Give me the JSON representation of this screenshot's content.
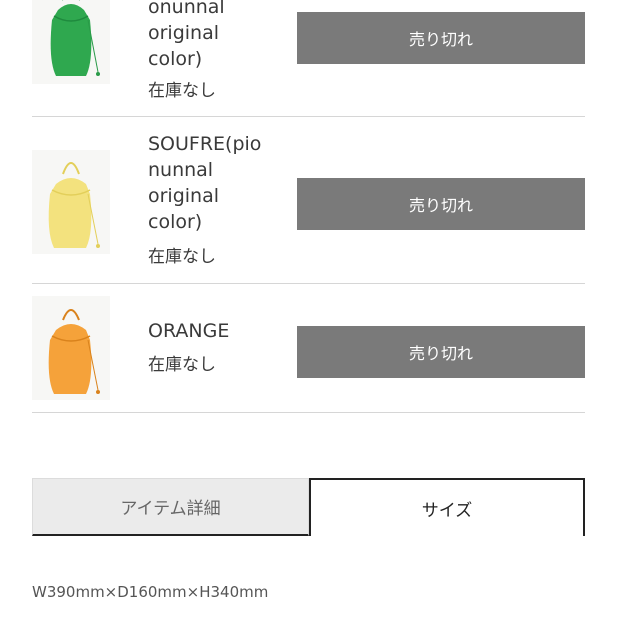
{
  "items": [
    {
      "name": "onunnal\n original\ncolor)",
      "stock": "在庫なし",
      "button": "売り切れ",
      "bag_color": "#2fa84f"
    },
    {
      "name": "SOUFRE(pio\nnunnal\n original\ncolor)",
      "stock": "在庫なし",
      "button": "売り切れ",
      "bag_color": "#f3e27e"
    },
    {
      "name": "ORANGE",
      "stock": "在庫なし",
      "button": "売り切れ",
      "bag_color": "#f5a23a"
    }
  ],
  "tabs": {
    "detail": "アイテム詳細",
    "size": "サイズ",
    "active": "size"
  },
  "size_info": "W390mm×D160mm×H340mm"
}
